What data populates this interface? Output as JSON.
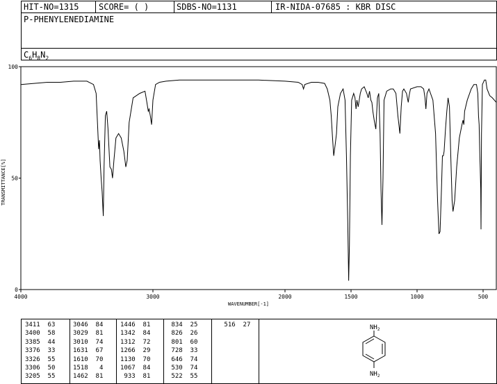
{
  "header": {
    "hit_no": "HIT-NO=1315",
    "score": "SCORE=  (   )",
    "sdbs_no": "SDBS-NO=1131",
    "ir_id": "IR-NIDA-07685 : KBR DISC"
  },
  "compound": {
    "name": "P-PHENYLENEDIAMINE",
    "formula": {
      "c": "C",
      "c_sub": "6",
      "h": "H",
      "h_sub": "8",
      "n": "N",
      "n_sub": "2"
    }
  },
  "structure": {
    "top_group": "NH",
    "top_sub": "2",
    "bottom_group": "NH",
    "bottom_sub": "2"
  },
  "chart_data": {
    "type": "line",
    "xlabel": "WAVENUMBER[-1]",
    "ylabel": "TRANSMITTANCE[%]",
    "xlim": [
      4000,
      400
    ],
    "x_reversed": true,
    "ylim": [
      0,
      100
    ],
    "x_ticks": [
      4000,
      3000,
      2000,
      1500,
      1000,
      500
    ],
    "y_ticks": [
      0,
      50,
      100
    ],
    "series": [
      {
        "values": [
          [
            4000,
            92
          ],
          [
            3900,
            92.5
          ],
          [
            3800,
            93
          ],
          [
            3700,
            93
          ],
          [
            3600,
            93.5
          ],
          [
            3500,
            93.5
          ],
          [
            3450,
            92
          ],
          [
            3430,
            88
          ],
          [
            3420,
            75
          ],
          [
            3411,
            63
          ],
          [
            3405,
            67
          ],
          [
            3400,
            58
          ],
          [
            3392,
            50
          ],
          [
            3385,
            44
          ],
          [
            3380,
            38
          ],
          [
            3376,
            33
          ],
          [
            3370,
            55
          ],
          [
            3360,
            78
          ],
          [
            3350,
            80
          ],
          [
            3340,
            72
          ],
          [
            3326,
            55
          ],
          [
            3315,
            54
          ],
          [
            3306,
            50
          ],
          [
            3295,
            58
          ],
          [
            3280,
            68
          ],
          [
            3260,
            70
          ],
          [
            3240,
            68
          ],
          [
            3220,
            62
          ],
          [
            3205,
            55
          ],
          [
            3195,
            58
          ],
          [
            3180,
            75
          ],
          [
            3150,
            86
          ],
          [
            3100,
            88
          ],
          [
            3060,
            89
          ],
          [
            3046,
            84
          ],
          [
            3035,
            80
          ],
          [
            3029,
            81
          ],
          [
            3020,
            78
          ],
          [
            3010,
            74
          ],
          [
            3000,
            85
          ],
          [
            2980,
            92
          ],
          [
            2950,
            93
          ],
          [
            2900,
            93.5
          ],
          [
            2800,
            94
          ],
          [
            2600,
            94
          ],
          [
            2400,
            94
          ],
          [
            2200,
            94
          ],
          [
            2000,
            93.5
          ],
          [
            1900,
            93
          ],
          [
            1870,
            92
          ],
          [
            1860,
            90
          ],
          [
            1850,
            92
          ],
          [
            1800,
            93
          ],
          [
            1750,
            93
          ],
          [
            1700,
            92.5
          ],
          [
            1680,
            90
          ],
          [
            1660,
            85
          ],
          [
            1650,
            78
          ],
          [
            1640,
            68
          ],
          [
            1631,
            60
          ],
          [
            1620,
            65
          ],
          [
            1610,
            70
          ],
          [
            1600,
            82
          ],
          [
            1580,
            88
          ],
          [
            1560,
            90
          ],
          [
            1545,
            85
          ],
          [
            1535,
            60
          ],
          [
            1525,
            30
          ],
          [
            1518,
            4
          ],
          [
            1512,
            20
          ],
          [
            1505,
            60
          ],
          [
            1495,
            85
          ],
          [
            1480,
            88
          ],
          [
            1470,
            86
          ],
          [
            1462,
            81
          ],
          [
            1455,
            85
          ],
          [
            1446,
            82
          ],
          [
            1430,
            88
          ],
          [
            1420,
            90
          ],
          [
            1400,
            91
          ],
          [
            1380,
            88
          ],
          [
            1370,
            86
          ],
          [
            1360,
            89
          ],
          [
            1350,
            85
          ],
          [
            1342,
            84
          ],
          [
            1335,
            80
          ],
          [
            1325,
            76
          ],
          [
            1312,
            72
          ],
          [
            1300,
            86
          ],
          [
            1290,
            88
          ],
          [
            1280,
            70
          ],
          [
            1273,
            45
          ],
          [
            1266,
            29
          ],
          [
            1258,
            50
          ],
          [
            1250,
            85
          ],
          [
            1230,
            89
          ],
          [
            1200,
            90
          ],
          [
            1180,
            90
          ],
          [
            1160,
            88
          ],
          [
            1145,
            78
          ],
          [
            1130,
            70
          ],
          [
            1120,
            82
          ],
          [
            1110,
            89
          ],
          [
            1100,
            90
          ],
          [
            1080,
            88
          ],
          [
            1067,
            84
          ],
          [
            1060,
            87
          ],
          [
            1050,
            90
          ],
          [
            1000,
            91
          ],
          [
            970,
            91
          ],
          [
            950,
            90
          ],
          [
            940,
            86
          ],
          [
            933,
            81
          ],
          [
            925,
            88
          ],
          [
            910,
            90
          ],
          [
            880,
            85
          ],
          [
            860,
            70
          ],
          [
            845,
            40
          ],
          [
            834,
            25
          ],
          [
            826,
            26
          ],
          [
            815,
            45
          ],
          [
            808,
            60
          ],
          [
            801,
            60
          ],
          [
            795,
            62
          ],
          [
            785,
            72
          ],
          [
            775,
            80
          ],
          [
            765,
            86
          ],
          [
            755,
            82
          ],
          [
            745,
            60
          ],
          [
            735,
            40
          ],
          [
            728,
            35
          ],
          [
            715,
            40
          ],
          [
            700,
            55
          ],
          [
            680,
            68
          ],
          [
            660,
            74
          ],
          [
            652,
            76
          ],
          [
            646,
            74
          ],
          [
            640,
            80
          ],
          [
            620,
            85
          ],
          [
            590,
            90
          ],
          [
            570,
            92
          ],
          [
            550,
            92
          ],
          [
            540,
            88
          ],
          [
            535,
            78
          ],
          [
            530,
            74
          ],
          [
            525,
            60
          ],
          [
            522,
            55
          ],
          [
            518,
            45
          ],
          [
            516,
            27
          ],
          [
            512,
            70
          ],
          [
            505,
            92
          ],
          [
            490,
            94
          ],
          [
            480,
            94
          ],
          [
            470,
            90
          ],
          [
            450,
            87
          ],
          [
            430,
            86
          ],
          [
            400,
            84
          ]
        ]
      }
    ]
  },
  "peak_table": {
    "columns": [
      [
        [
          "3411",
          "63"
        ],
        [
          "3400",
          "58"
        ],
        [
          "3385",
          "44"
        ],
        [
          "3376",
          "33"
        ],
        [
          "3326",
          "55"
        ],
        [
          "3306",
          "50"
        ],
        [
          "3205",
          "55"
        ]
      ],
      [
        [
          "3046",
          "84"
        ],
        [
          "3029",
          "81"
        ],
        [
          "3010",
          "74"
        ],
        [
          "1631",
          "67"
        ],
        [
          "1610",
          "70"
        ],
        [
          "1518",
          "4"
        ],
        [
          "1462",
          "81"
        ]
      ],
      [
        [
          "1446",
          "81"
        ],
        [
          "1342",
          "84"
        ],
        [
          "1312",
          "72"
        ],
        [
          "1266",
          "29"
        ],
        [
          "1130",
          "70"
        ],
        [
          "1067",
          "84"
        ],
        [
          "933",
          "81"
        ]
      ],
      [
        [
          "834",
          "25"
        ],
        [
          "826",
          "26"
        ],
        [
          "801",
          "60"
        ],
        [
          "728",
          "33"
        ],
        [
          "646",
          "74"
        ],
        [
          "530",
          "74"
        ],
        [
          "522",
          "55"
        ]
      ],
      [
        [
          "516",
          "27"
        ]
      ]
    ]
  }
}
